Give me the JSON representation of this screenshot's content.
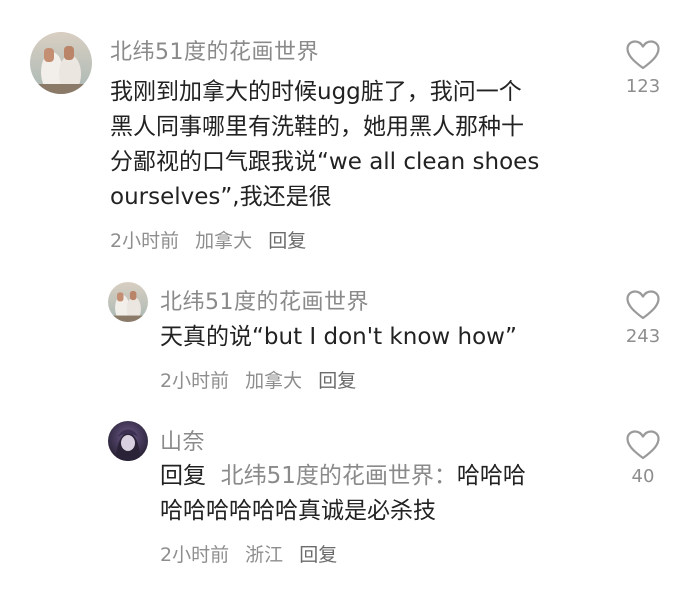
{
  "comments": [
    {
      "author": "北纬51度的花画世界",
      "lines": [
        "我刚到加拿大的时候ugg脏了，我问一个",
        "黑人同事哪里有洗鞋的，她用黑人那种十",
        "分鄙视的口气跟我说“we all clean shoes",
        "ourselves”,我还是很"
      ],
      "time": "2小时前",
      "location": "加拿大",
      "reply_label": "回复",
      "likes": "123"
    },
    {
      "author": "北纬51度的花画世界",
      "lines": [
        "天真的说“but I don't know how”"
      ],
      "time": "2小时前",
      "location": "加拿大",
      "reply_label": "回复",
      "likes": "243"
    },
    {
      "author": "山奈",
      "reply_prefix": "回复",
      "reply_target": "北纬51度的花画世界：",
      "line1_rest": "哈哈哈",
      "line2": "哈哈哈哈哈哈真诚是必杀技",
      "time": "2小时前",
      "location": "浙江",
      "reply_label": "回复",
      "likes": "40"
    }
  ],
  "colors": {
    "name": "#8a8a8a",
    "text": "#222222",
    "meta": "#8e8e8e",
    "heart": "#9a9a9a"
  },
  "icons": [
    "heart-outline-icon"
  ]
}
